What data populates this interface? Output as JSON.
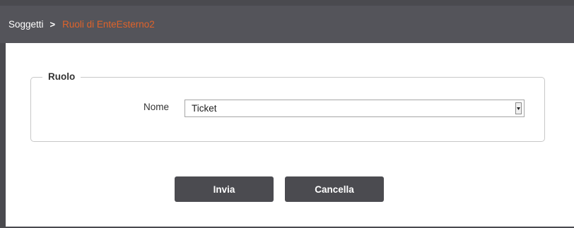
{
  "breadcrumb": {
    "root": "Soggetti",
    "separator_icon": "chevron-right-icon",
    "current": "Ruoli di EnteEsterno2"
  },
  "form": {
    "legend": "Ruolo",
    "field": {
      "label": "Nome",
      "value": "Ticket"
    }
  },
  "buttons": {
    "submit": "Invia",
    "cancel": "Cancella"
  },
  "colors": {
    "header_bg": "#54545a",
    "accent": "#e0632a",
    "button_bg": "#4b4b50"
  }
}
